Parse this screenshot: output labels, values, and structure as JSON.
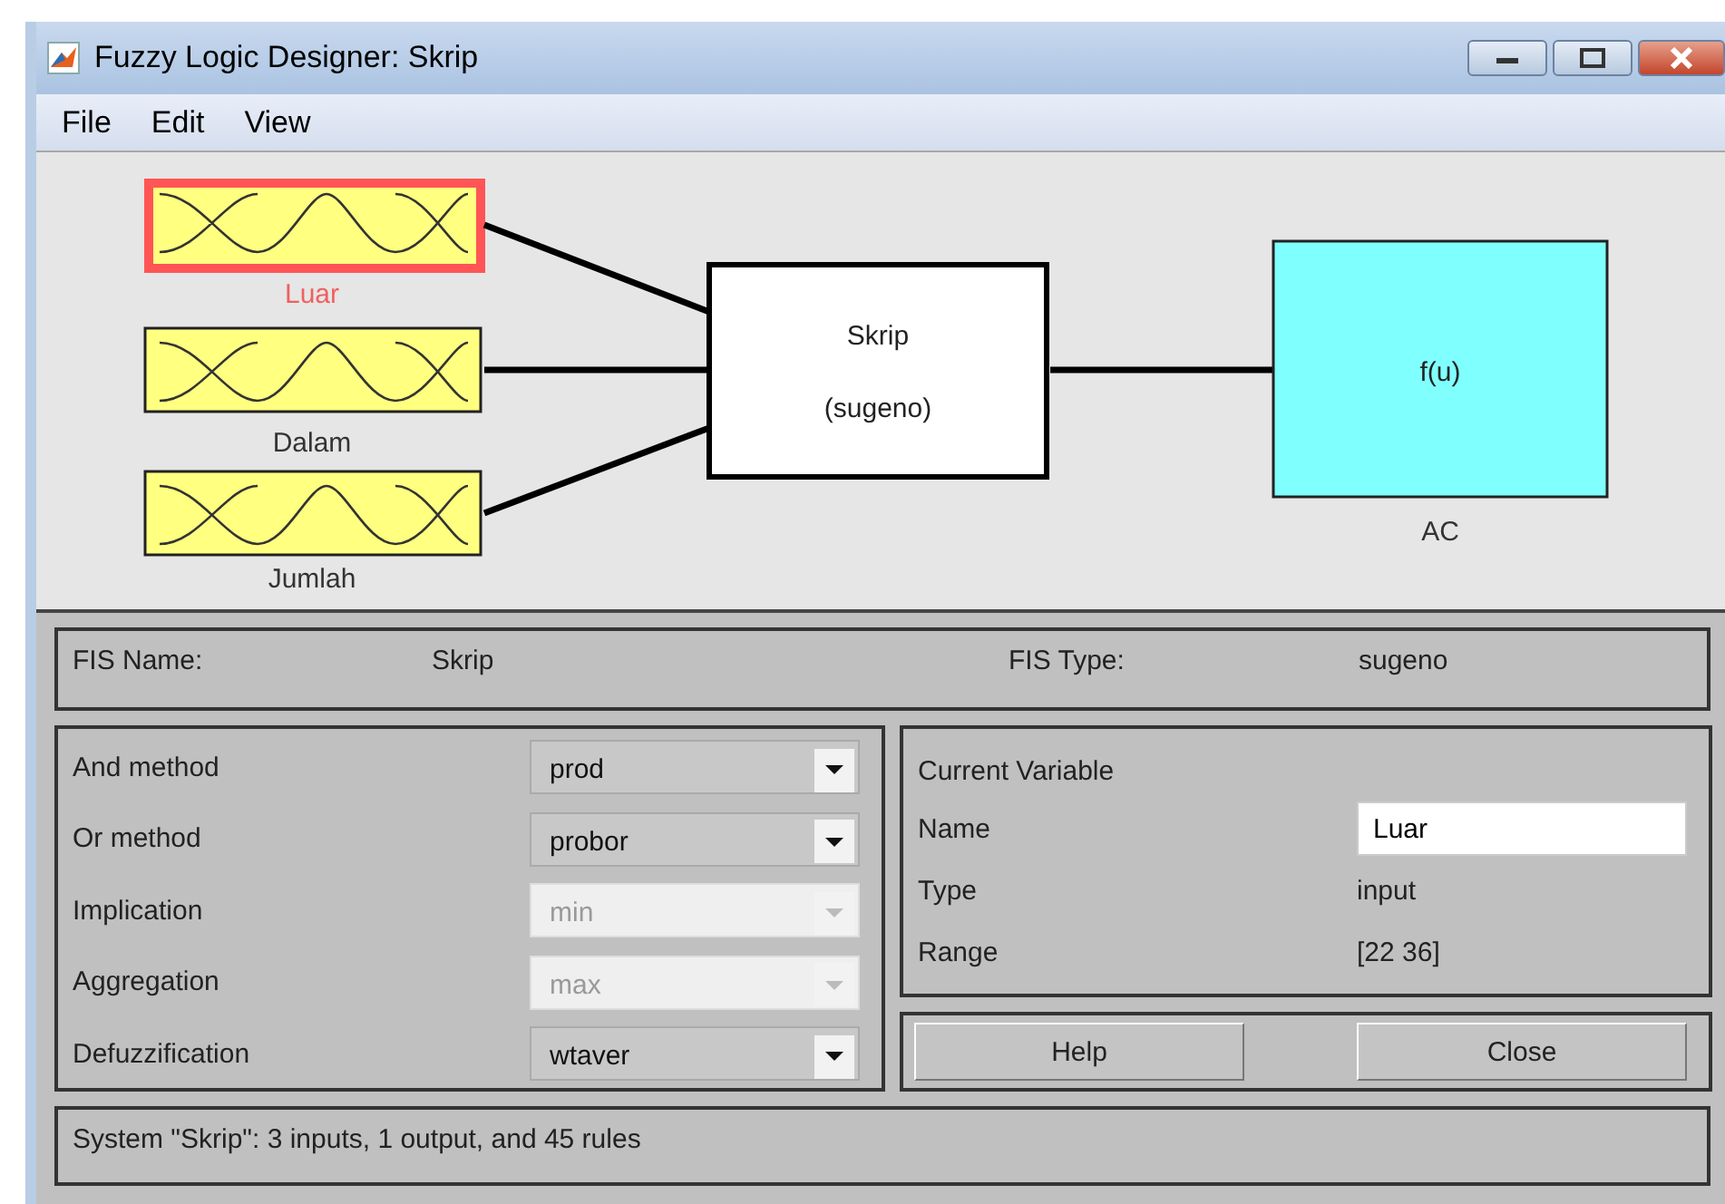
{
  "window": {
    "title": "Fuzzy Logic Designer: Skrip"
  },
  "menu": [
    "File",
    "Edit",
    "View"
  ],
  "diagram": {
    "inputs": [
      {
        "name": "Luar",
        "selected": true
      },
      {
        "name": "Dalam",
        "selected": false
      },
      {
        "name": "Jumlah",
        "selected": false
      }
    ],
    "system": {
      "name": "Skrip",
      "type": "(sugeno)"
    },
    "output": {
      "name": "AC",
      "function": "f(u)",
      "selected": false
    }
  },
  "fis": {
    "name_label": "FIS Name:",
    "name": "Skrip",
    "type_label": "FIS Type:",
    "type": "sugeno"
  },
  "methods": [
    {
      "label": "And method",
      "value": "prod",
      "disabled": false
    },
    {
      "label": "Or method",
      "value": "probor",
      "disabled": false
    },
    {
      "label": "Implication",
      "value": "min",
      "disabled": true
    },
    {
      "label": "Aggregation",
      "value": "max",
      "disabled": true
    },
    {
      "label": "Defuzzification",
      "value": "wtaver",
      "disabled": false
    }
  ],
  "current_variable": {
    "title": "Current Variable",
    "name_label": "Name",
    "name": "Luar",
    "type_label": "Type",
    "type": "input",
    "range_label": "Range",
    "range": "[22 36]"
  },
  "buttons": [
    "Help",
    "Close"
  ],
  "status_bar": "System \"Skrip\": 3 inputs, 1 output, and 45 rules"
}
